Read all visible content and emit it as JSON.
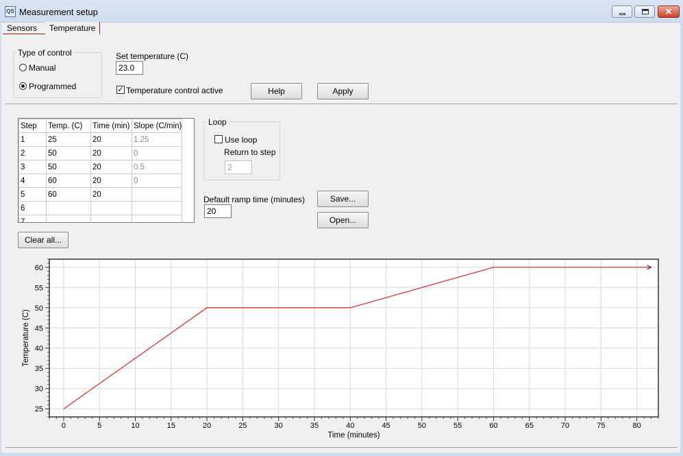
{
  "window": {
    "title": "Measurement setup",
    "icon_text": "QS",
    "close_glyph": "✕"
  },
  "tabs": [
    {
      "label": "Sensors",
      "active": false
    },
    {
      "label": "Temperature",
      "active": true
    }
  ],
  "control": {
    "group_label": "Type of control",
    "manual_label": "Manual",
    "programmed_label": "Programmed",
    "selected": "Programmed",
    "set_temp_label": "Set temperature (C)",
    "set_temp_value": "23.0",
    "temp_active_label": "Temperature control active",
    "temp_active_checked": true,
    "help_label": "Help",
    "apply_label": "Apply"
  },
  "program_table": {
    "headers": [
      "Step",
      "Temp. (C)",
      "Time (min)",
      "Slope (C/min)"
    ],
    "rows": [
      [
        "1",
        "25",
        "20",
        "1.25"
      ],
      [
        "2",
        "50",
        "20",
        "0"
      ],
      [
        "3",
        "50",
        "20",
        "0.5"
      ],
      [
        "4",
        "60",
        "20",
        "0"
      ],
      [
        "5",
        "60",
        "20",
        ""
      ],
      [
        "6",
        "",
        "",
        ""
      ],
      [
        "7",
        "",
        "",
        ""
      ]
    ]
  },
  "loop": {
    "group_label": "Loop",
    "use_loop_label": "Use loop",
    "use_loop_checked": false,
    "return_label": "Return to step",
    "return_value": "2"
  },
  "ramp": {
    "label": "Default ramp time (minutes)",
    "value": "20"
  },
  "buttons": {
    "save_label": "Save...",
    "open_label": "Open...",
    "clear_label": "Clear all..."
  },
  "colors": {
    "series": "#e02020",
    "arrow": "#5a2a6a"
  },
  "chart_data": {
    "type": "line",
    "title": "",
    "xlabel": "Time (minutes)",
    "ylabel": "Temperature (C)",
    "xlim": [
      -2,
      83
    ],
    "ylim": [
      23,
      62
    ],
    "xticks": [
      0,
      5,
      10,
      15,
      20,
      25,
      30,
      35,
      40,
      45,
      50,
      55,
      60,
      65,
      70,
      75,
      80
    ],
    "yticks": [
      25,
      30,
      35,
      40,
      45,
      50,
      55,
      60
    ],
    "grid": true,
    "series": [
      {
        "x": [
          0,
          20,
          40,
          60,
          82
        ],
        "y": [
          25,
          50,
          50,
          60,
          60
        ]
      }
    ]
  }
}
